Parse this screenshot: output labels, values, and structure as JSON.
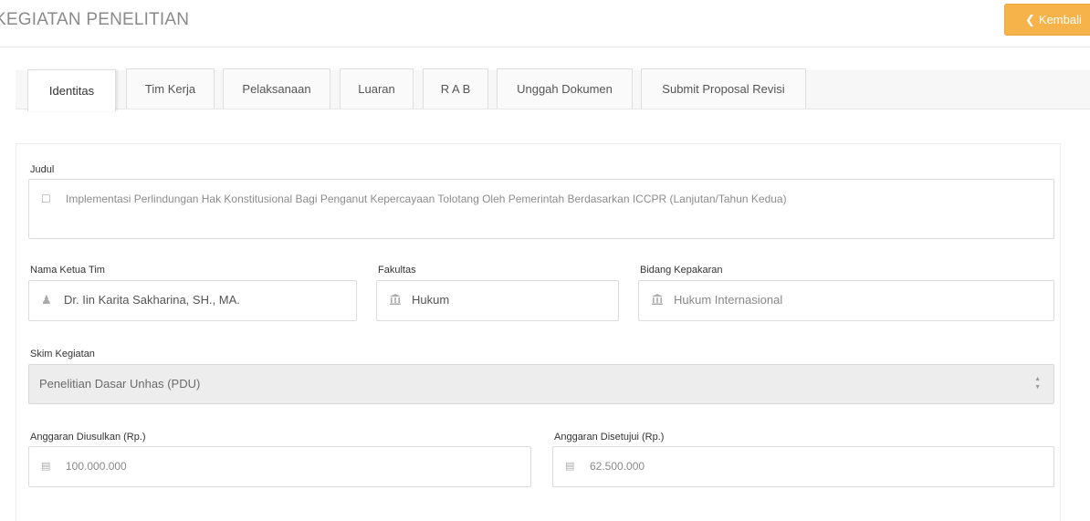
{
  "header": {
    "title": "KEGIATAN PENELITIAN",
    "back_label": "Kembali",
    "back_icon": "chevron-left-icon"
  },
  "tabs": [
    {
      "label": "Identitas",
      "active": true
    },
    {
      "label": "Tim Kerja",
      "active": false
    },
    {
      "label": "Pelaksanaan",
      "active": false
    },
    {
      "label": "Luaran",
      "active": false
    },
    {
      "label": "R A B",
      "active": false
    },
    {
      "label": "Unggah Dokumen",
      "active": false
    },
    {
      "label": "Submit Proposal Revisi",
      "active": false
    }
  ],
  "form": {
    "judul": {
      "label": "Judul",
      "value": "Implementasi Perlindungan Hak Konstitusional Bagi Penganut Kepercayaan Tolotang Oleh Pemerintah Berdasarkan ICCPR (Lanjutan/Tahun Kedua)",
      "icon": "document-icon"
    },
    "ketua": {
      "label": "Nama Ketua Tim",
      "value": "Dr. Iin Karita Sakharina, SH., MA.",
      "icon": "user-icon"
    },
    "fakultas": {
      "label": "Fakultas",
      "value": "Hukum",
      "icon": "institution-icon"
    },
    "bidang": {
      "label": "Bidang Kepakaran",
      "value": "Hukum Internasional",
      "icon": "institution-icon"
    },
    "skim": {
      "label": "Skim Kegiatan",
      "value": "Penelitian Dasar Unhas (PDU)"
    },
    "anggaran_diusulkan": {
      "label": "Anggaran Diusulkan (Rp.)",
      "value": "100.000.000",
      "icon": "money-icon"
    },
    "anggaran_disetujui": {
      "label": "Anggaran Disetujui (Rp.)",
      "value": "62.500.000",
      "icon": "money-icon"
    }
  },
  "colors": {
    "accent": "#f5b34a",
    "title": "#8a8a8a"
  }
}
